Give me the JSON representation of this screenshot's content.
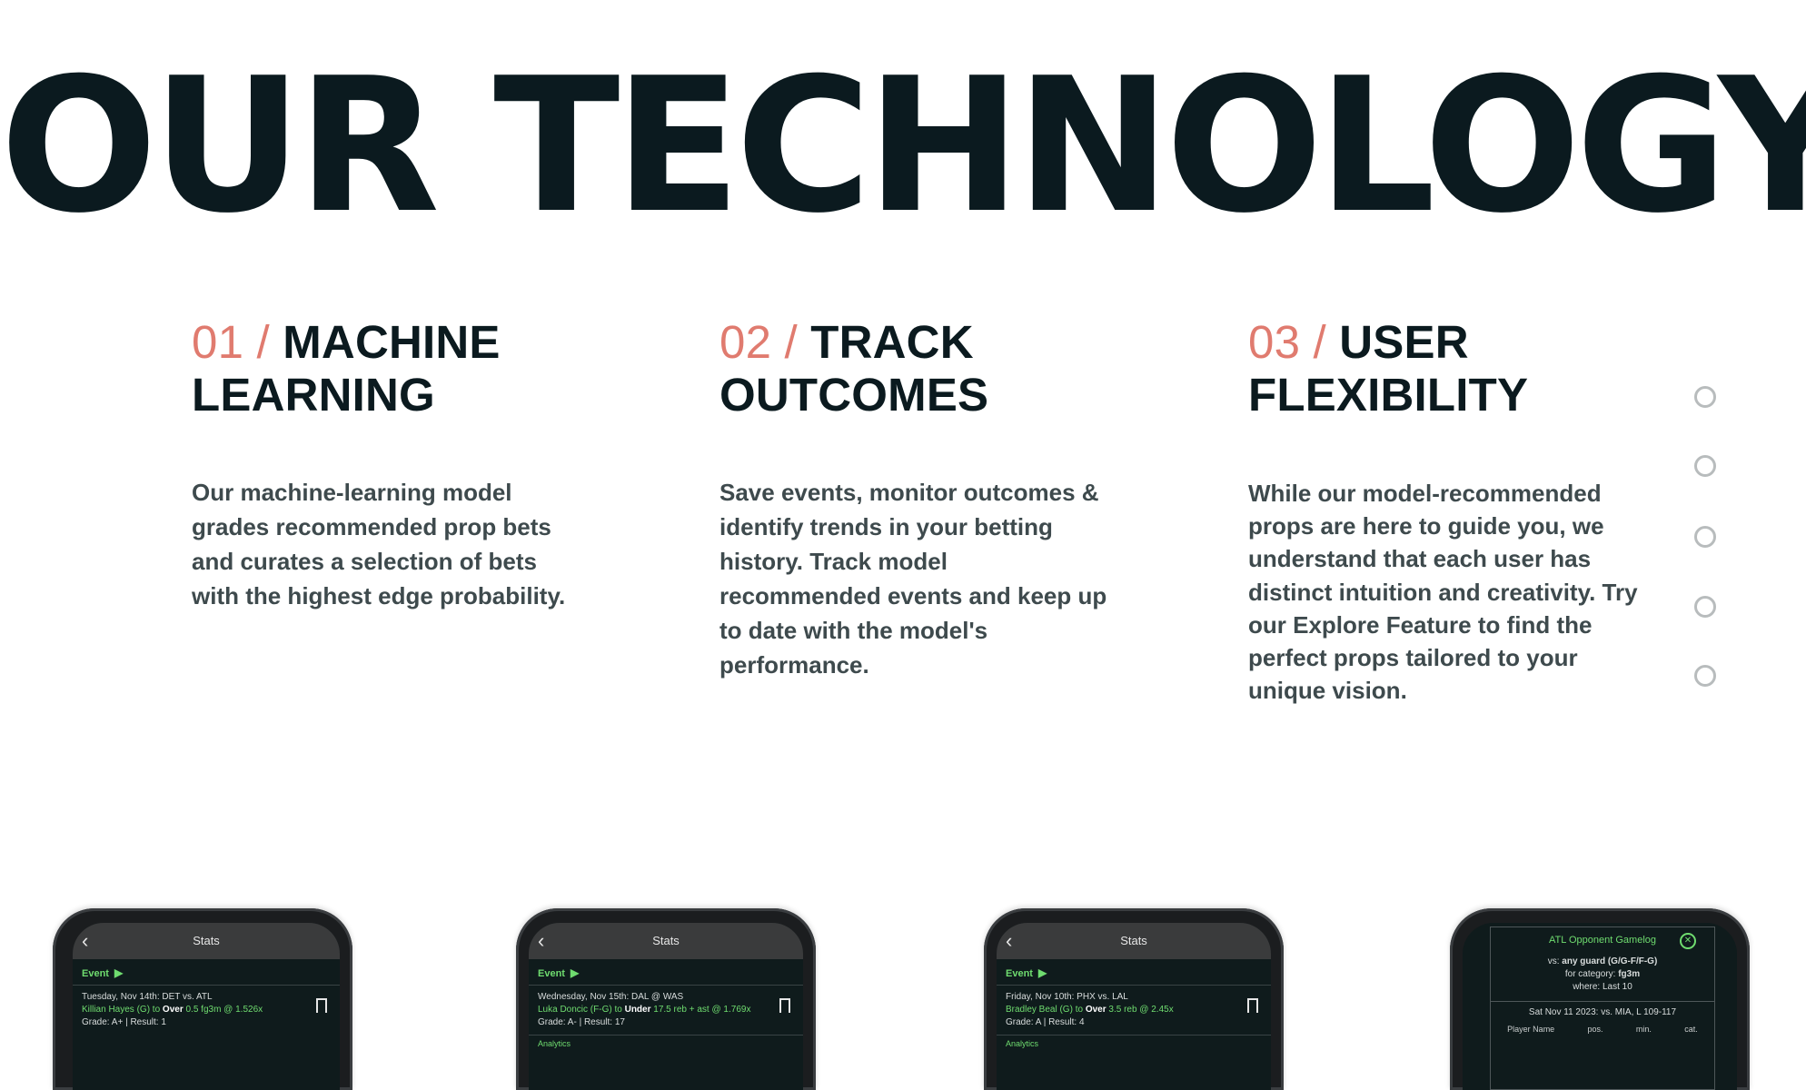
{
  "hero": {
    "title": "OUR TECHNOLOGY"
  },
  "features": [
    {
      "num": "01 /",
      "title_l1": "MACHINE",
      "title_l2": "LEARNING",
      "body": "Our machine-learning model grades recommended prop bets and curates a selection of bets with the highest edge probability."
    },
    {
      "num": "02 /",
      "title_l1": "TRACK",
      "title_l2": "OUTCOMES",
      "body": "Save events, monitor outcomes & identify trends in your betting history. Track model recommended events and keep up to date with the model's performance."
    },
    {
      "num": "03 /",
      "title_l1": "USER",
      "title_l2": "FLEXIBILITY",
      "body": "While our model-recommended props are here to guide you, we understand that each user has distinct intuition and creativity. Try our Explore Feature to find the perfect props tailored to your unique vision."
    }
  ],
  "slider": {
    "dot_count": 5
  },
  "phones": [
    {
      "header": "Stats",
      "event_label": "Event",
      "line1": "Tuesday, Nov 14th: DET vs. ATL",
      "line2_pre": "Killian Hayes (G) to ",
      "line2_bold": "Over",
      "line2_post": " 0.5 fg3m @ 1.526x",
      "line3": "Grade: A+ | Result: 1"
    },
    {
      "header": "Stats",
      "event_label": "Event",
      "line1": "Wednesday, Nov 15th: DAL @ WAS",
      "line2_pre": "Luka Doncic (F-G) to ",
      "line2_bold": "Under",
      "line2_post": " 17.5 reb + ast @ 1.769x",
      "line3": "Grade: A- | Result: 17",
      "more": "Analytics"
    },
    {
      "header": "Stats",
      "event_label": "Event",
      "line1": "Friday, Nov 10th: PHX vs. LAL",
      "line2_pre": "Bradley Beal (G) to ",
      "line2_bold": "Over",
      "line2_post": " 3.5 reb @ 2.45x",
      "line3": "Grade: A | Result: 4",
      "more": "Analytics"
    },
    {
      "modal_title": "ATL Opponent Gamelog",
      "vs_pre": "vs: ",
      "vs_bold": "any guard (G/G-F/F-G)",
      "cat_pre": "for category: ",
      "cat_bold": "fg3m",
      "where": "where: Last 10",
      "game": "Sat Nov 11 2023: vs. MIA, L 109-117",
      "col1": "Player Name",
      "col2": "pos.",
      "col3": "min.",
      "col4": "cat."
    }
  ],
  "colors": {
    "accent": "#e07b6f",
    "dark": "#0b1a1f",
    "body": "#3e4a4d",
    "green": "#6fdc6f"
  }
}
